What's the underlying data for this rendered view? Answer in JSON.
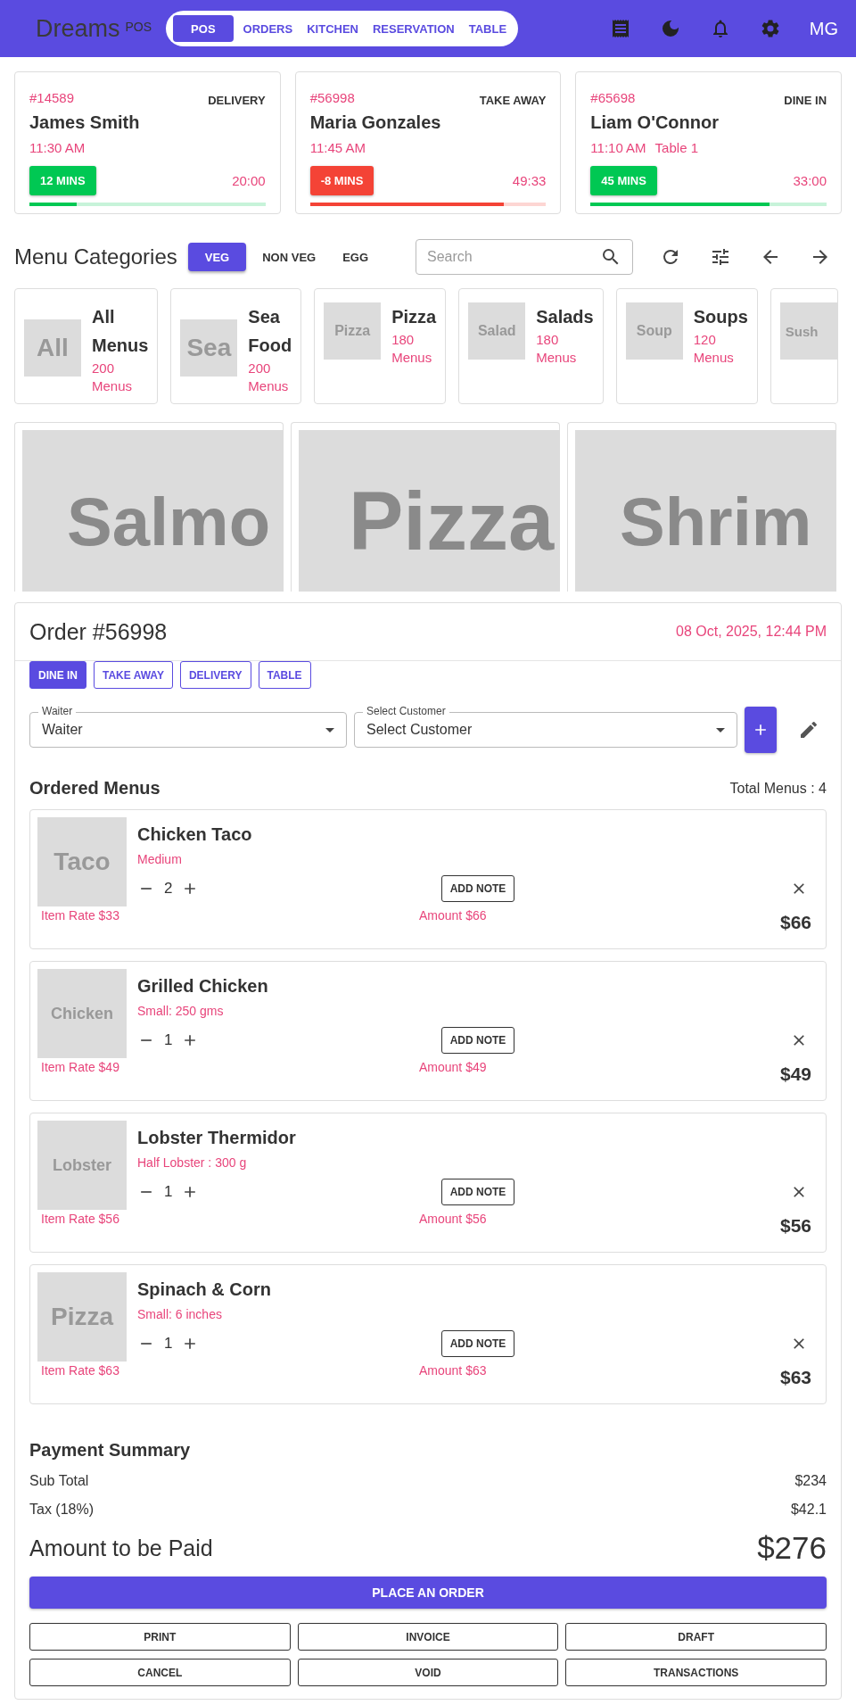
{
  "header": {
    "logo": "Dreams",
    "logo_badge": "POS",
    "nav": [
      {
        "label": "POS",
        "selected": true
      },
      {
        "label": "ORDERS",
        "selected": false
      },
      {
        "label": "KITCHEN",
        "selected": false
      },
      {
        "label": "RESERVATION",
        "selected": false
      },
      {
        "label": "TABLE",
        "selected": false
      }
    ],
    "avatar": "MG"
  },
  "orders": [
    {
      "number": "#14589",
      "type": "DELIVERY",
      "name": "James Smith",
      "time": "11:30 AM",
      "timer": "12 MINS",
      "color": "#00c853",
      "elapsed": "20:00",
      "level": 0.2
    },
    {
      "number": "#56998",
      "type": "TAKE AWAY",
      "name": "Maria Gonzales",
      "time": "11:45 AM",
      "timer": "-8 MINS",
      "color": "#f44336",
      "elapsed": "49:33",
      "level": 0.82
    },
    {
      "number": "#65698",
      "type": "DINE IN",
      "name": "Liam O'Connor",
      "time": "11:10 AM",
      "table": "Table 1",
      "timer": "45 MINS",
      "color": "#00c853",
      "elapsed": "33:00",
      "level": 0.76
    }
  ],
  "menu": {
    "title": "Menu Categories",
    "filters": [
      {
        "label": "VEG",
        "selected": true
      },
      {
        "label": "NON VEG",
        "selected": false
      },
      {
        "label": "EGG",
        "selected": false
      }
    ],
    "search": {
      "placeholder": "Search"
    },
    "categories": [
      {
        "thumb": "All",
        "name": "All Menus",
        "count": "200 Menus"
      },
      {
        "thumb": "Sea",
        "name": "Sea Food",
        "count": "200 Menus"
      },
      {
        "thumb": "Pizza",
        "name": "Pizza",
        "count": "180 Menus"
      },
      {
        "thumb": "Salad",
        "name": "Salads",
        "count": "180 Menus"
      },
      {
        "thumb": "Soup",
        "name": "Soups",
        "count": "120 Menus"
      },
      {
        "thumb": "Sush"
      }
    ],
    "dishes": [
      {
        "thumb": "Salmo"
      },
      {
        "thumb": "Pizza"
      },
      {
        "thumb": "Shrim"
      }
    ]
  },
  "order": {
    "title": "Order #56998",
    "date": "08 Oct, 2025, 12:44 PM",
    "types": [
      {
        "label": "DINE IN",
        "selected": true
      },
      {
        "label": "TAKE AWAY",
        "selected": false
      },
      {
        "label": "DELIVERY",
        "selected": false
      },
      {
        "label": "TABLE",
        "selected": false
      }
    ],
    "waiter": {
      "label": "Waiter",
      "value": "Waiter"
    },
    "customer": {
      "label": "Select Customer",
      "value": "Select Customer"
    },
    "ordered_title": "Ordered Menus",
    "total_menus": "Total Menus : 4",
    "items": [
      {
        "thumb": "Taco",
        "name": "Chicken Taco",
        "variant": "Medium",
        "qty": "2",
        "note": "ADD NOTE",
        "rate": "Item Rate $33",
        "amount": "Amount $66",
        "total": "$66"
      },
      {
        "thumb": "Chicken",
        "name": "Grilled Chicken",
        "variant": "Small: 250 gms",
        "qty": "1",
        "note": "ADD NOTE",
        "rate": "Item Rate $49",
        "amount": "Amount $49",
        "total": "$49"
      },
      {
        "thumb": "Lobster",
        "name": "Lobster Thermidor",
        "variant": "Half Lobster : 300 g",
        "qty": "1",
        "note": "ADD NOTE",
        "rate": "Item Rate $56",
        "amount": "Amount $56",
        "total": "$56"
      },
      {
        "thumb": "Pizza",
        "name": "Spinach & Corn",
        "variant": "Small: 6 inches",
        "qty": "1",
        "note": "ADD NOTE",
        "rate": "Item Rate $63",
        "amount": "Amount $63",
        "total": "$63"
      }
    ],
    "payment": {
      "title": "Payment Summary",
      "rows": [
        {
          "label": "Sub Total",
          "value": "$234"
        },
        {
          "label": "Tax (18%)",
          "value": "$42.1"
        }
      ],
      "total_label": "Amount to be Paid",
      "total_value": "$276",
      "primary": "PLACE AN ORDER",
      "actions": [
        "PRINT",
        "INVOICE",
        "DRAFT",
        "CANCEL",
        "VOID",
        "TRANSACTIONS"
      ]
    }
  }
}
